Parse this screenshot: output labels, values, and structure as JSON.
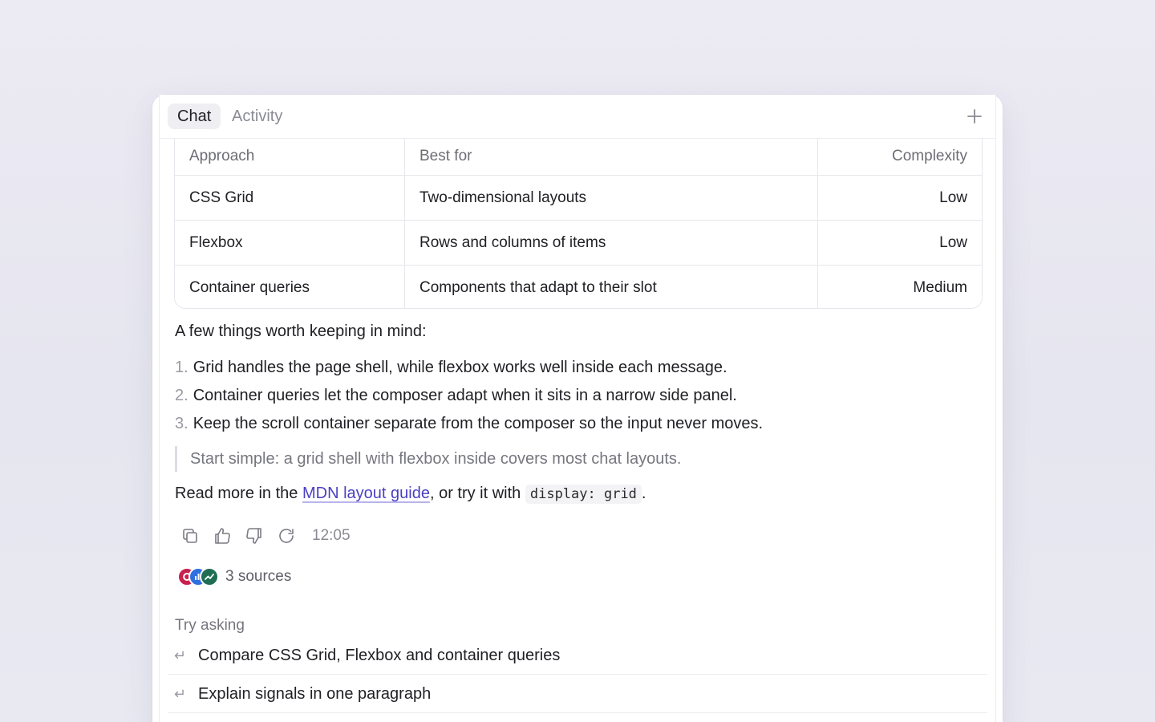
{
  "tabs": [
    {
      "label": "Chat",
      "active": true
    },
    {
      "label": "Activity",
      "active": false
    }
  ],
  "new_tab_icon": "plus-icon",
  "table": {
    "headers": [
      "Approach",
      "Best for",
      "Complexity"
    ],
    "rows": [
      [
        "CSS Grid",
        "Two-dimensional layouts",
        "Low"
      ],
      [
        "Flexbox",
        "Rows and columns of items",
        "Low"
      ],
      [
        "Container queries",
        "Components that adapt to their slot",
        "Medium"
      ]
    ]
  },
  "message": {
    "intro": "A few things worth keeping in mind:",
    "list": [
      {
        "num": "1.",
        "text": "Grid handles the page shell, while flexbox works well inside each message."
      },
      {
        "num": "2.",
        "text": "Container queries let the composer adapt when it sits in a narrow side panel."
      },
      {
        "num": "3.",
        "text": "Keep the scroll container separate from the composer so the input never moves."
      }
    ],
    "quote": "Start simple: a grid shell with flexbox inside covers most chat layouts.",
    "readmore_prefix": "Read more in the ",
    "link_text": "MDN layout guide",
    "readmore_middle": ", or try it with ",
    "code_text": "display: grid",
    "readmore_suffix": "."
  },
  "actions": {
    "icons": [
      "copy-icon",
      "thumbs-up-icon",
      "thumbs-down-icon",
      "regenerate-icon"
    ],
    "timestamp": "12:05"
  },
  "sources": {
    "label": "3 sources",
    "colors": [
      "#c8204f",
      "#2f6fe0",
      "#1f6e54"
    ]
  },
  "suggestions": {
    "heading": "Try asking",
    "items": [
      "Compare CSS Grid, Flexbox and container queries",
      "Explain signals in one paragraph"
    ]
  },
  "colors": {
    "accent_link": "#4a3fc2",
    "muted_text": "#8a8a94"
  }
}
